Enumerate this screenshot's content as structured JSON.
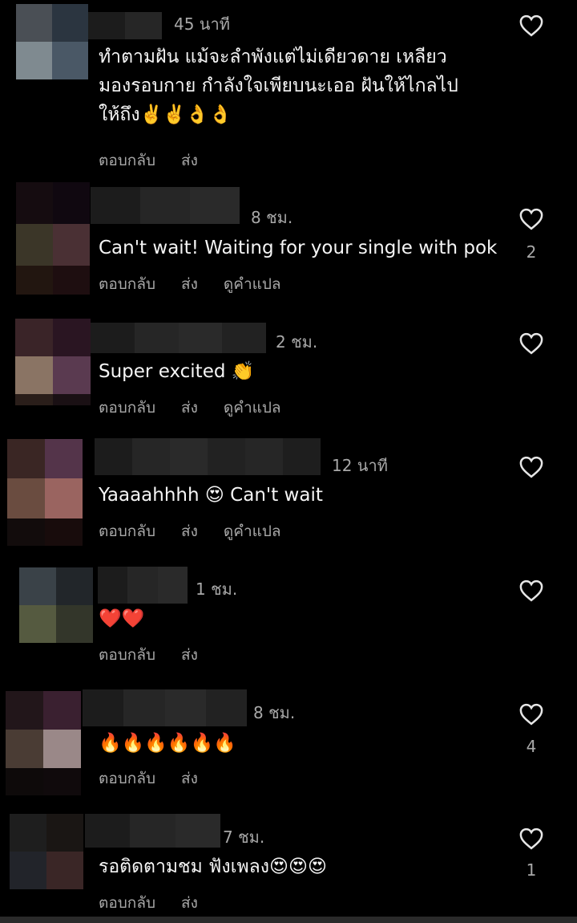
{
  "labels": {
    "reply": "ตอบกลับ",
    "send": "ส่ง",
    "translate": "ดูคำแปล"
  },
  "comments": [
    {
      "time": "45 นาที",
      "text_lines": [
        "ทำตามฝัน แม้จะลำพังแต่ไม่เดียวดาย เหลียว",
        "มองรอบกาย กำลังใจเพียบนะเออ ฝันให้ไกลไป",
        "ให้ถึง✌️✌️👌👌"
      ],
      "likes": "",
      "show_translate": false
    },
    {
      "time": "8 ชม.",
      "text_lines": [
        "Can't wait! Waiting for your single with pok"
      ],
      "likes": "2",
      "show_translate": true
    },
    {
      "time": "2 ชม.",
      "text_lines": [
        "Super excited 👏"
      ],
      "likes": "",
      "show_translate": true
    },
    {
      "time": "12 นาที",
      "text_lines": [
        "Yaaaahhhh 😍 Can't wait"
      ],
      "likes": "",
      "show_translate": true
    },
    {
      "time": "1 ชม.",
      "text_lines": [
        "❤️❤️"
      ],
      "likes": "",
      "show_translate": false
    },
    {
      "time": "8 ชม.",
      "text_lines": [
        "🔥🔥🔥🔥🔥🔥"
      ],
      "likes": "4",
      "show_translate": false
    },
    {
      "time": "7 ชม.",
      "text_lines": [
        "รอติดตามชม ฟังเพลง😍😍😍"
      ],
      "likes": "1",
      "show_translate": false
    }
  ],
  "icons": {
    "like": "heart-outline-icon"
  },
  "colors": {
    "background": "#000000",
    "text": "#f5f5f5",
    "secondary": "#a8a8a8"
  }
}
